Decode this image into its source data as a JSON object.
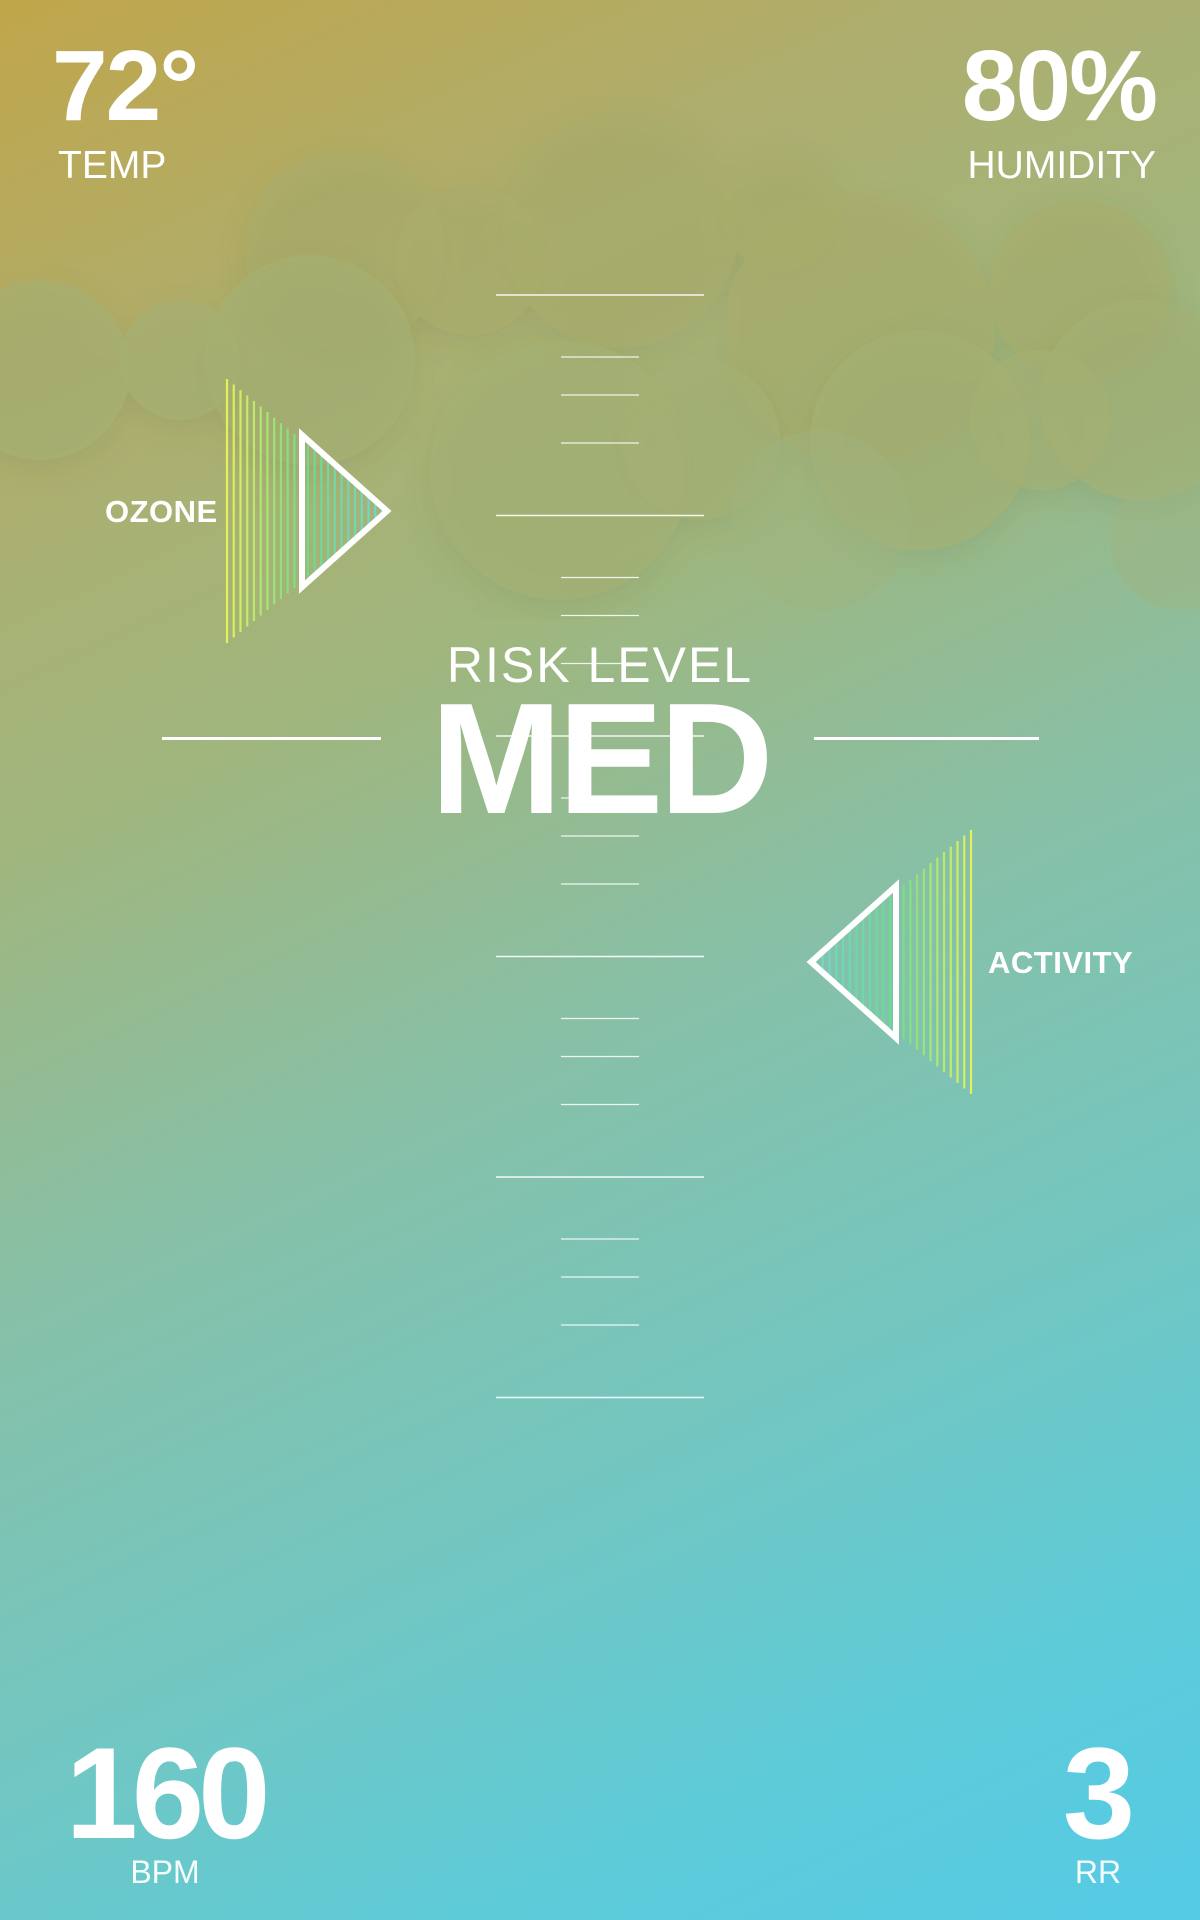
{
  "temperature": {
    "value": "72°",
    "label": "TEMP"
  },
  "humidity": {
    "value": "80%",
    "label": "HUMIDITY"
  },
  "heart_rate": {
    "value": "160",
    "label": "BPM"
  },
  "respiratory_rate": {
    "value": "3",
    "label": "RR"
  },
  "risk": {
    "title": "RISK LEVEL",
    "value": "MED"
  },
  "indicators": {
    "ozone": {
      "label": "OZONE",
      "direction": "right"
    },
    "activity": {
      "label": "ACTIVITY",
      "direction": "left"
    }
  },
  "colors": {
    "gradient_top": "#c0a64a",
    "gradient_bottom": "#55cbe6",
    "indicator_yellow": "#e6f05a",
    "indicator_green": "#6cdc8a",
    "indicator_teal": "#70d6cf",
    "text": "#ffffff"
  }
}
